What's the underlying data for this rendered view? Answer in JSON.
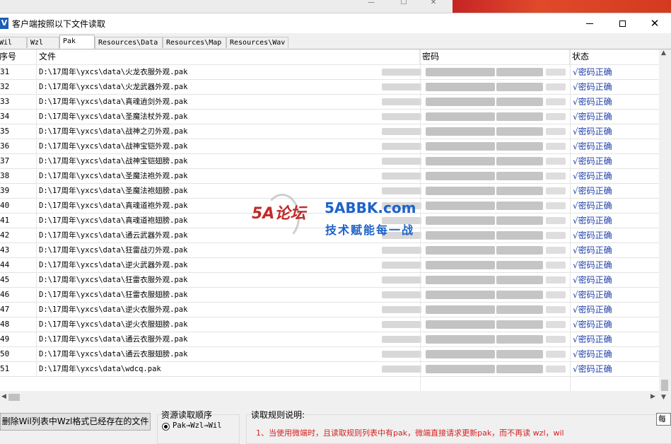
{
  "window": {
    "title": "客户端按照以下文件读取",
    "icon": "V"
  },
  "tabs": [
    {
      "label": "Wil"
    },
    {
      "label": "Wzl"
    },
    {
      "label": "Pak"
    },
    {
      "label": "Resources\\Data"
    },
    {
      "label": "Resources\\Map"
    },
    {
      "label": "Resources\\Wav"
    }
  ],
  "active_tab": "Pak",
  "table": {
    "headers": {
      "no": "序号",
      "file": "文件",
      "pwd": "密码",
      "status": "状态"
    },
    "rows": [
      {
        "no": "31",
        "file": "D:\\17周年\\yxcs\\data\\火龙衣服外观.pak",
        "status": "√密码正确"
      },
      {
        "no": "32",
        "file": "D:\\17周年\\yxcs\\data\\火龙武器外观.pak",
        "status": "√密码正确"
      },
      {
        "no": "33",
        "file": "D:\\17周年\\yxcs\\data\\真魂逍剑外观.pak",
        "status": "√密码正确"
      },
      {
        "no": "34",
        "file": "D:\\17周年\\yxcs\\data\\圣魔法杖外观.pak",
        "status": "√密码正确"
      },
      {
        "no": "35",
        "file": "D:\\17周年\\yxcs\\data\\战神之刃外观.pak",
        "status": "√密码正确"
      },
      {
        "no": "36",
        "file": "D:\\17周年\\yxcs\\data\\战神宝铠外观.pak",
        "status": "√密码正确"
      },
      {
        "no": "37",
        "file": "D:\\17周年\\yxcs\\data\\战神宝铠翅膀.pak",
        "status": "√密码正确"
      },
      {
        "no": "38",
        "file": "D:\\17周年\\yxcs\\data\\圣魔法袍外观.pak",
        "status": "√密码正确"
      },
      {
        "no": "39",
        "file": "D:\\17周年\\yxcs\\data\\圣魔法袍翅膀.pak",
        "status": "√密码正确"
      },
      {
        "no": "40",
        "file": "D:\\17周年\\yxcs\\data\\真魂道袍外观.pak",
        "status": "√密码正确"
      },
      {
        "no": "41",
        "file": "D:\\17周年\\yxcs\\data\\真魂道袍翅膀.pak",
        "status": "√密码正确"
      },
      {
        "no": "42",
        "file": "D:\\17周年\\yxcs\\data\\通云武器外观.pak",
        "status": "√密码正确"
      },
      {
        "no": "43",
        "file": "D:\\17周年\\yxcs\\data\\狂雷战刃外观.pak",
        "status": "√密码正确"
      },
      {
        "no": "44",
        "file": "D:\\17周年\\yxcs\\data\\逆火武器外观.pak",
        "status": "√密码正确"
      },
      {
        "no": "45",
        "file": "D:\\17周年\\yxcs\\data\\狂雷衣服外观.pak",
        "status": "√密码正确"
      },
      {
        "no": "46",
        "file": "D:\\17周年\\yxcs\\data\\狂雷衣服翅膀.pak",
        "status": "√密码正确"
      },
      {
        "no": "47",
        "file": "D:\\17周年\\yxcs\\data\\逆火衣服外观.pak",
        "status": "√密码正确"
      },
      {
        "no": "48",
        "file": "D:\\17周年\\yxcs\\data\\逆火衣服翅膀.pak",
        "status": "√密码正确"
      },
      {
        "no": "49",
        "file": "D:\\17周年\\yxcs\\data\\通云衣服外观.pak",
        "status": "√密码正确"
      },
      {
        "no": "50",
        "file": "D:\\17周年\\yxcs\\data\\通云衣服翅膀.pak",
        "status": "√密码正确"
      },
      {
        "no": "51",
        "file": "D:\\17周年\\yxcs\\data\\wdcq.pak",
        "status": "√密码正确"
      }
    ]
  },
  "bottom": {
    "delete_button": "删除Wil列表中Wzl格式已经存在的文件",
    "order_title": "资源读取顺序",
    "order_option": "Pak→Wzl→Wil",
    "rules_title": "读取规则说明:",
    "rules_line1": "1、当使用微端时，且读取规则列表中有pak，微端直接请求更新pak，而不再读 wzl，wil",
    "tooltip": "每"
  },
  "watermark": {
    "logo": "5A论坛",
    "site": "5ABBK.com",
    "slogan": "技术赋能每一战"
  },
  "colors": {
    "status_text": "#1f3fa8",
    "rules_text": "#d61f1f",
    "accent": "#1c5fb4"
  }
}
